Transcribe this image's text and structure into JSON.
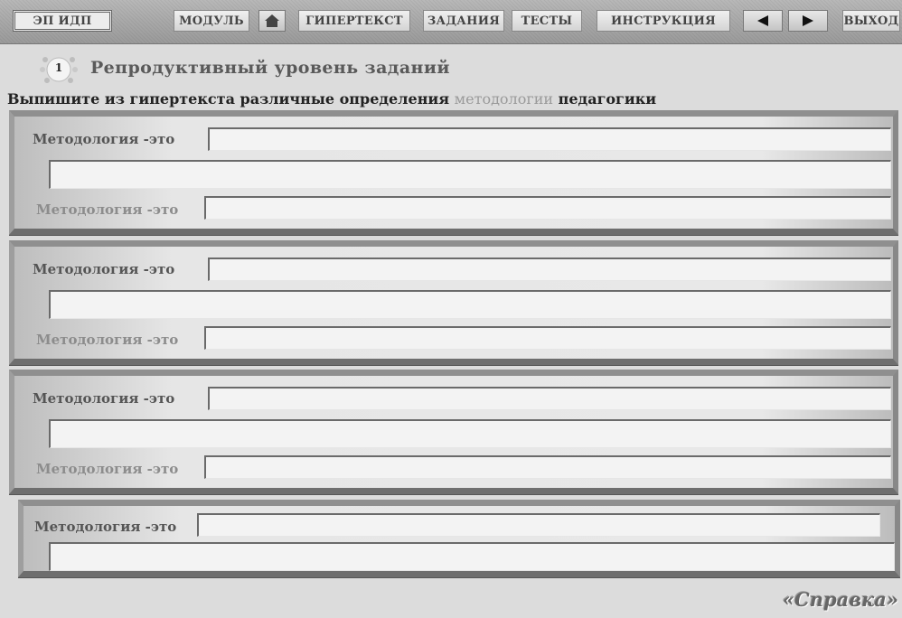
{
  "nav": {
    "ep_idp": "ЭП ИДП",
    "module": "МОДУЛЬ",
    "hypertext": "ГИПЕРТЕКСТ",
    "tasks": "ЗАДАНИЯ",
    "tests": "ТЕСТЫ",
    "instruction": "ИНСТРУКЦИЯ",
    "exit": "ВЫХОД",
    "icons": [
      "home-icon",
      "arrow-left-icon",
      "arrow-right-icon"
    ]
  },
  "header": {
    "badge_number": "1",
    "level_title": "Репродуктивный уровень заданий",
    "instruction_prefix": "Выпишите из гипертекста различные определения",
    "instruction_term1": "методологии",
    "instruction_term2": "педагогики"
  },
  "panels": [
    {
      "label_top": "Методология -это",
      "label_bottom": "Методология -это",
      "value_top": "",
      "value_middle": "",
      "value_bottom": ""
    },
    {
      "label_top": "Методология -это",
      "label_bottom": "Методология -это",
      "value_top": "",
      "value_middle": "",
      "value_bottom": ""
    },
    {
      "label_top": "Методология -это",
      "label_bottom": "Методология -это",
      "value_top": "",
      "value_middle": "",
      "value_bottom": ""
    },
    {
      "label_top": "Методология -это",
      "value_top": "",
      "value_middle": ""
    }
  ],
  "help_link": "«Справка»",
  "colors": {
    "background": "#dcdcdc",
    "panel_border": "#8f8f8f",
    "text_dark": "#222222",
    "text_grey": "#9a9a9a"
  }
}
